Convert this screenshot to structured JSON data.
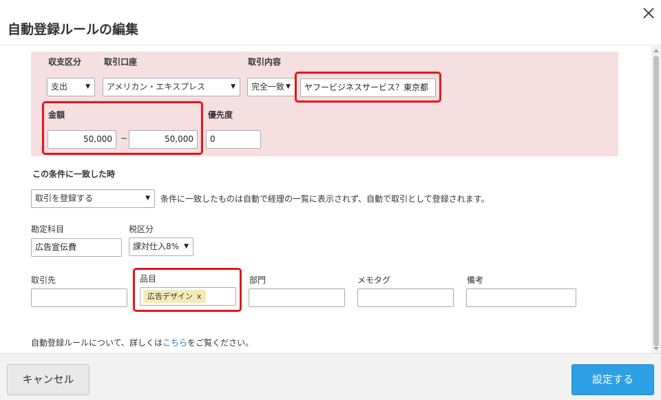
{
  "dialog": {
    "title": "自動登録ルールの編集"
  },
  "conditions": {
    "income_expense": {
      "label": "収支区分",
      "value": "支出"
    },
    "account": {
      "label": "取引口座",
      "value": "アメリカン・エキスプレス"
    },
    "content": {
      "label": "取引内容",
      "match_value": "完全一致",
      "text_value": "ヤフービジネスサービス？東京都"
    },
    "amount": {
      "label": "金額",
      "min": "50,000",
      "tilde": "~",
      "max": "50,000"
    },
    "priority": {
      "label": "優先度",
      "value": "0"
    }
  },
  "action": {
    "heading": "この条件に一致した時",
    "select_value": "取引を登録する",
    "description": "条件に一致したものは自動で経理の一覧に表示されず、自動で取引として登録されます。",
    "account_item": {
      "label": "勘定科目",
      "value": "広告宣伝費"
    },
    "tax": {
      "label": "税区分",
      "value": "課対仕入8%"
    },
    "partner": {
      "label": "取引先",
      "value": ""
    },
    "item": {
      "label": "品目",
      "tag": "広告デザイン",
      "tag_remove": "x"
    },
    "department": {
      "label": "部門",
      "value": ""
    },
    "memo_tag": {
      "label": "メモタグ",
      "value": ""
    },
    "remarks": {
      "label": "備考",
      "value": ""
    }
  },
  "help": {
    "prefix": "自動登録ルールについて、詳しくは",
    "link": "こちら",
    "suffix": "をご覧ください。"
  },
  "footer": {
    "cancel_label": "キャンセル",
    "save_label": "設定する"
  },
  "colors": {
    "condition_bg": "#f6dfe1",
    "highlight_red": "#e8141b",
    "primary_button": "#2ea0e6",
    "link": "#1e78c8",
    "tag_bg": "#f2ecb5"
  },
  "icons": {
    "close": "close-icon",
    "dropdown": "chevron-down-icon"
  }
}
